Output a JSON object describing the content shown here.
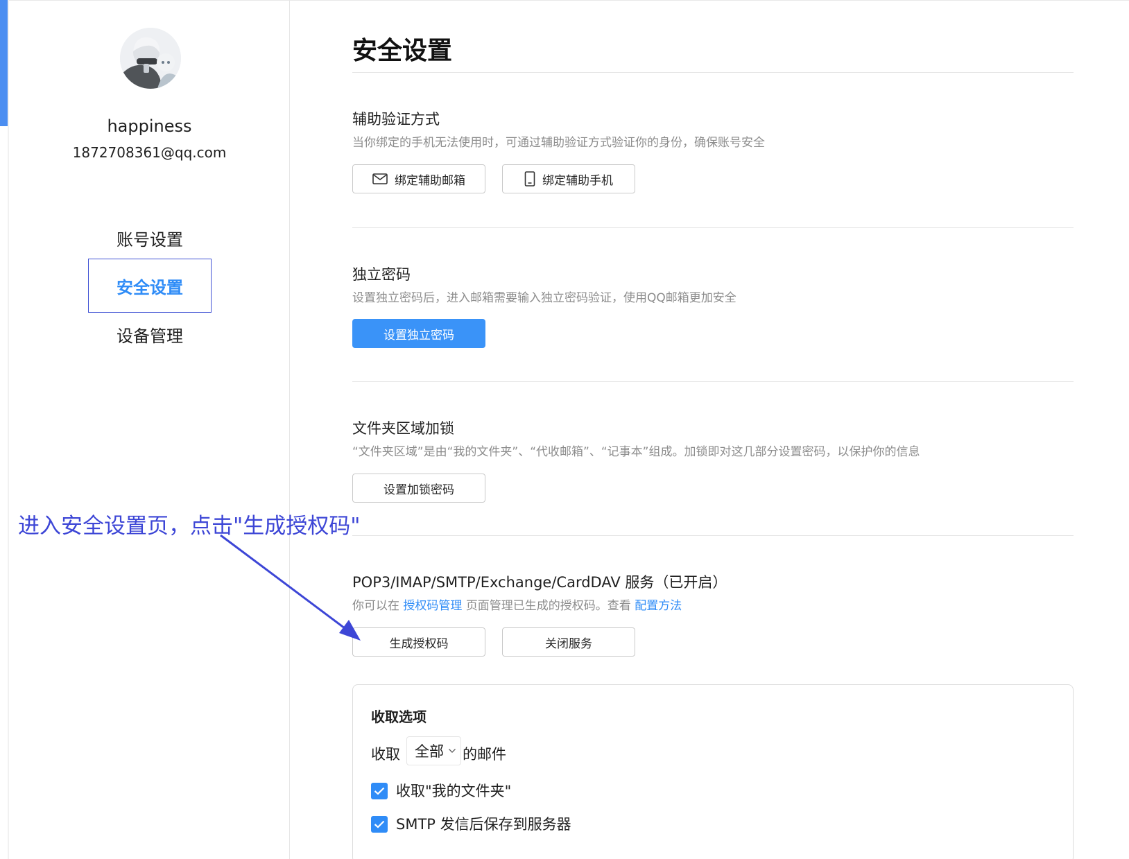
{
  "colors": {
    "accent_blue": "#2f8cf7",
    "primary_button": "#3a93f8",
    "annotation": "#3d46d6",
    "muted_text": "#8c8c8c"
  },
  "profile": {
    "username": "happiness",
    "email": "1872708361@qq.com"
  },
  "sidebar": {
    "items": [
      {
        "label": "账号设置",
        "active": false
      },
      {
        "label": "安全设置",
        "active": true
      },
      {
        "label": "设备管理",
        "active": false
      }
    ]
  },
  "main": {
    "title": "安全设置",
    "sections": {
      "aux_verify": {
        "title": "辅助验证方式",
        "desc": "当你绑定的手机无法使用时，可通过辅助验证方式验证你的身份，确保账号安全",
        "btn_email": "绑定辅助邮箱",
        "btn_email_icon": "mail-icon",
        "btn_phone": "绑定辅助手机",
        "btn_phone_icon": "phone-icon"
      },
      "standalone_password": {
        "title": "独立密码",
        "desc": "设置独立密码后，进入邮箱需要输入独立密码验证，使用QQ邮箱更加安全",
        "btn": "设置独立密码"
      },
      "folder_lock": {
        "title": "文件夹区域加锁",
        "desc": "“文件夹区域”是由“我的文件夹”、“代收邮箱”、“记事本”组成。加锁即对这几部分设置密码，以保护你的信息",
        "btn": "设置加锁密码"
      },
      "pop3": {
        "title": "POP3/IMAP/SMTP/Exchange/CardDAV 服务（已开启）",
        "desc_prefix": "你可以在",
        "desc_link1": "授权码管理",
        "desc_middle": "页面管理已生成的授权码。查看",
        "desc_link2": "配置方法",
        "btn_generate": "生成授权码",
        "btn_close": "关闭服务"
      }
    },
    "receive_options": {
      "title": "收取选项",
      "receive_prefix": "收取",
      "select_value": "全部",
      "receive_suffix": "的邮件",
      "checkbox1_label": "收取\"我的文件夹\"",
      "checkbox1_checked": true,
      "checkbox2_label": "SMTP 发信后保存到服务器",
      "checkbox2_checked": true
    }
  },
  "annotation": {
    "text": "进入安全设置页，点击\"生成授权码\""
  }
}
